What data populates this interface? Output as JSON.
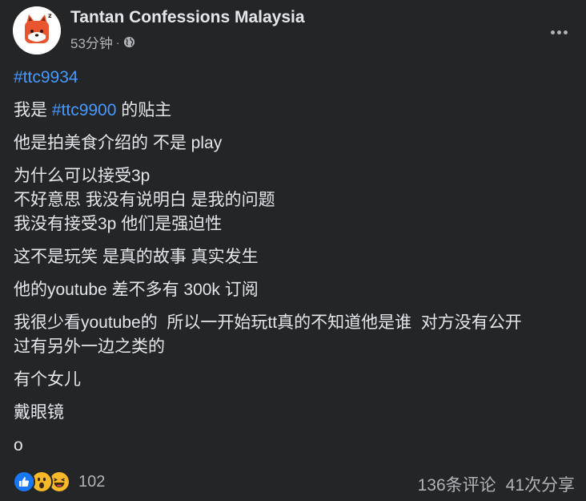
{
  "post": {
    "page_name": "Tantan Confessions Malaysia",
    "time": "53分钟",
    "separator": "·",
    "privacy_icon": "globe-icon",
    "more_icon": "more-horizontal-icon",
    "avatar_icon": "fox-logo",
    "lines": {
      "hashtag_top": "#ttc9934",
      "p1_prefix": "我是 ",
      "p1_hashtag": "#ttc9900",
      "p1_suffix": " 的贴主",
      "p2": "他是拍美食介绍的 不是 play",
      "p3_l1": "为什么可以接受3p",
      "p3_l2": "不好意思 我没有说明白 是我的问题",
      "p3_l3": "我没有接受3p 他们是强迫性",
      "p4": "这不是玩笑 是真的故事 真实发生",
      "p5": "他的youtube 差不多有 300k 订阅",
      "p6_l1": "我很少看youtube的  所以一开始玩tt真的不知道他是谁  对方没有公开",
      "p6_l2": "过有另外一边之类的",
      "p7": "有个女儿",
      "p8": "戴眼镜",
      "p9": "o"
    }
  },
  "footer": {
    "reactions": [
      "like-icon",
      "wow-icon",
      "haha-icon"
    ],
    "reaction_count": "102",
    "comments": "136条评论",
    "shares": "41次分享"
  },
  "colors": {
    "background": "#242526",
    "text": "#e4e6eb",
    "secondary": "#b0b3b8",
    "link": "#4599ff",
    "like": "#1877f2",
    "emoji": "#f7b928"
  }
}
